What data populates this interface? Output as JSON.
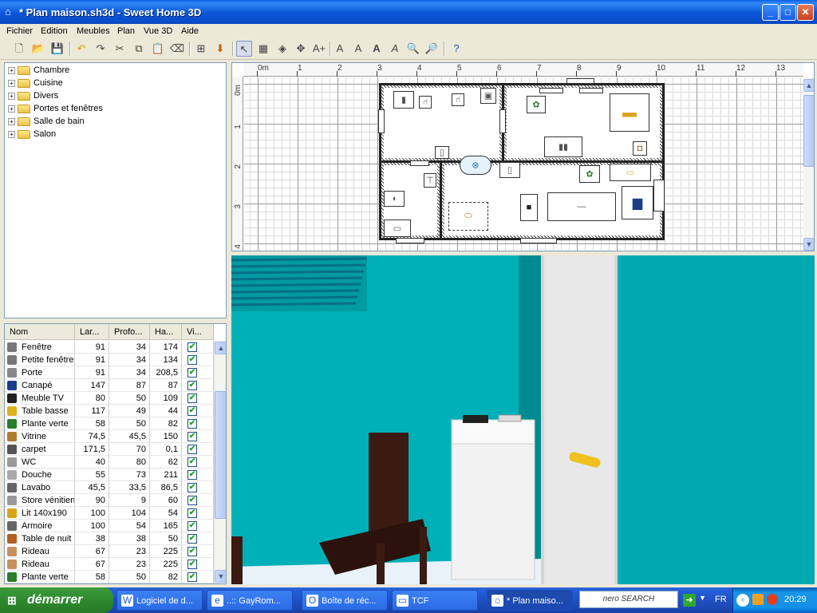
{
  "window": {
    "title": "* Plan maison.sh3d - Sweet Home 3D",
    "minimize": "_",
    "maximize": "□",
    "close": "✕"
  },
  "menu": [
    "Fichier",
    "Edition",
    "Meubles",
    "Plan",
    "Vue 3D",
    "Aide"
  ],
  "catalog": {
    "categories": [
      "Chambre",
      "Cuisine",
      "Divers",
      "Portes et fenêtres",
      "Salle de bain",
      "Salon"
    ]
  },
  "furniture_table": {
    "headers": [
      "Nom",
      "Lar...",
      "Profo...",
      "Ha...",
      "Vi..."
    ],
    "rows": [
      {
        "name": "Fenêtre",
        "width": "91",
        "depth": "34",
        "height": "174",
        "visible": "✔"
      },
      {
        "name": "Petite fenêtre",
        "width": "91",
        "depth": "34",
        "height": "134",
        "visible": "✔"
      },
      {
        "name": "Porte",
        "width": "91",
        "depth": "34",
        "height": "208,5",
        "visible": "✔"
      },
      {
        "name": "Canapé",
        "width": "147",
        "depth": "87",
        "height": "87",
        "visible": "✔"
      },
      {
        "name": "Meuble TV",
        "width": "80",
        "depth": "50",
        "height": "109",
        "visible": "✔"
      },
      {
        "name": "Table basse",
        "width": "117",
        "depth": "49",
        "height": "44",
        "visible": "✔"
      },
      {
        "name": "Plante verte",
        "width": "58",
        "depth": "50",
        "height": "82",
        "visible": "✔"
      },
      {
        "name": "Vitrine",
        "width": "74,5",
        "depth": "45,5",
        "height": "150",
        "visible": "✔"
      },
      {
        "name": "carpet",
        "width": "171,5",
        "depth": "70",
        "height": "0,1",
        "visible": "✔"
      },
      {
        "name": "WC",
        "width": "40",
        "depth": "80",
        "height": "62",
        "visible": "✔"
      },
      {
        "name": "Douche",
        "width": "55",
        "depth": "73",
        "height": "211",
        "visible": "✔"
      },
      {
        "name": "Lavabo",
        "width": "45,5",
        "depth": "33,5",
        "height": "86,5",
        "visible": "✔"
      },
      {
        "name": "Store vénitien",
        "width": "90",
        "depth": "9",
        "height": "60",
        "visible": "✔"
      },
      {
        "name": "Lit 140x190",
        "width": "100",
        "depth": "104",
        "height": "54",
        "visible": "✔"
      },
      {
        "name": "Armoire",
        "width": "100",
        "depth": "54",
        "height": "165",
        "visible": "✔"
      },
      {
        "name": "Table de nuit",
        "width": "38",
        "depth": "38",
        "height": "50",
        "visible": "✔"
      },
      {
        "name": "Rideau",
        "width": "67",
        "depth": "23",
        "height": "225",
        "visible": "✔"
      },
      {
        "name": "Rideau",
        "width": "67",
        "depth": "23",
        "height": "225",
        "visible": "✔"
      },
      {
        "name": "Plante verte",
        "width": "58",
        "depth": "50",
        "height": "82",
        "visible": "✔"
      }
    ]
  },
  "plan": {
    "ruler_x": [
      "0m",
      "1",
      "2",
      "3",
      "4",
      "5",
      "6",
      "7",
      "8",
      "9",
      "10",
      "11",
      "12",
      "13"
    ],
    "ruler_y": [
      "0m",
      "1",
      "2",
      "3",
      "4"
    ]
  },
  "taskbar": {
    "start": "démarrer",
    "tasks": [
      "Logiciel de d...",
      "..:: GayRom...",
      "Boîte de réc...",
      "TCF",
      "* Plan maiso..."
    ],
    "search": "nero SEARCH",
    "lang": "FR",
    "clock": "20:29"
  },
  "colors": {
    "wall3d": "#00b0b8",
    "titlebar": "#0a56d8",
    "start": "#2e8a2e"
  }
}
